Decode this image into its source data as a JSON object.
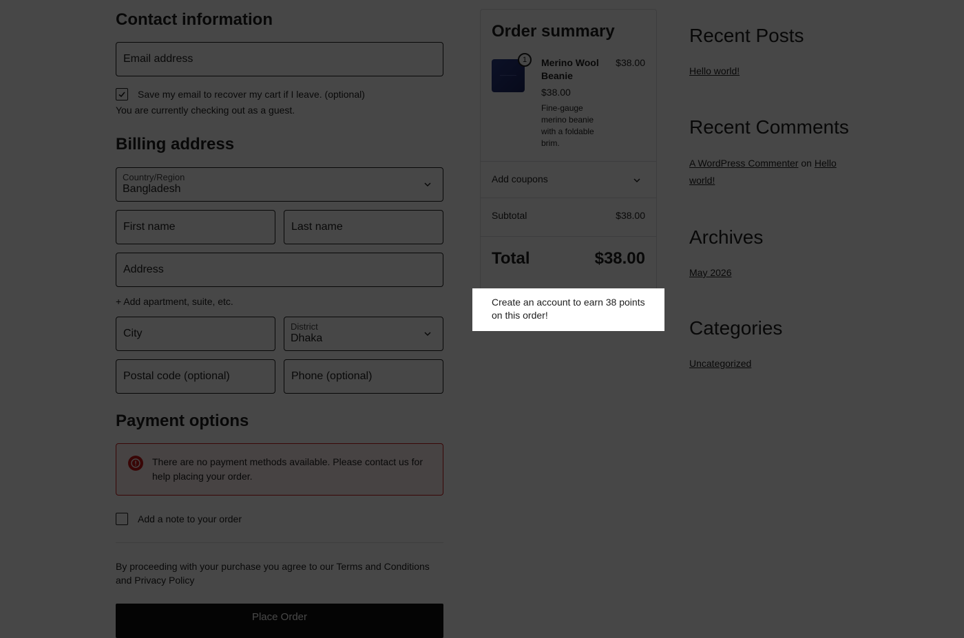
{
  "contact": {
    "heading": "Contact information",
    "email_placeholder": "Email address",
    "save_email_label": "Save my email to recover my cart if I leave. (optional)",
    "guest_text": "You are currently checking out as a guest."
  },
  "billing": {
    "heading": "Billing address",
    "country_label": "Country/Region",
    "country_value": "Bangladesh",
    "first_name": "First name",
    "last_name": "Last name",
    "address": "Address",
    "add_apartment": "+ Add apartment, suite, etc.",
    "city": "City",
    "district_label": "District",
    "district_value": "Dhaka",
    "postal": "Postal code (optional)",
    "phone": "Phone (optional)"
  },
  "payment": {
    "heading": "Payment options",
    "error": "There are no payment methods available. Please contact us for help placing your order.",
    "note_label": "Add a note to your order",
    "terms": "By proceeding with your purchase you agree to our Terms and Conditions and Privacy Policy",
    "place_order": "Place Order"
  },
  "summary": {
    "title": "Order summary",
    "item": {
      "quantity": "1",
      "name": "Merino Wool Beanie",
      "price": "$38.00",
      "description": "Fine-gauge merino beanie with a foldable brim.",
      "line_total": "$38.00"
    },
    "coupons": "Add coupons",
    "subtotal_label": "Subtotal",
    "subtotal_value": "$38.00",
    "total_label": "Total",
    "total_value": "$38.00",
    "points_message": "Create an account to earn 38 points on this order!"
  },
  "sidebar": {
    "recent_posts": {
      "heading": "Recent Posts",
      "items": [
        "Hello world!"
      ]
    },
    "recent_comments": {
      "heading": "Recent Comments",
      "author": "A WordPress Commenter",
      "on": "on",
      "post": "Hello world!"
    },
    "archives": {
      "heading": "Archives",
      "items": [
        "May 2026"
      ]
    },
    "categories": {
      "heading": "Categories",
      "items": [
        "Uncategorized"
      ]
    }
  },
  "colors": {
    "error_border": "#cc1818",
    "error_bg": "#fff0f0",
    "button_bg": "#111111",
    "overlay": "rgba(0,0,0,0.72)"
  }
}
